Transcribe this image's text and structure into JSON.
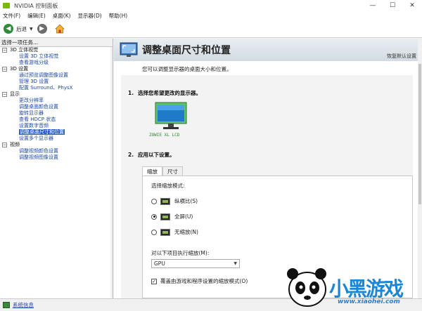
{
  "window": {
    "title": "NVIDIA 控制面板",
    "minimize": "—",
    "maximize": "☐",
    "close": "✕"
  },
  "menu": [
    "文件(F)",
    "编辑(E)",
    "桌面(K)",
    "显示器(D)",
    "帮助(H)"
  ],
  "toolbar": {
    "back_label": "后退",
    "back_dropdown": "▼"
  },
  "sidebar": {
    "header": "选择一项任务...",
    "categories": [
      {
        "label": "3D 立体视觉",
        "toggle": "−",
        "items": [
          {
            "label": "设置 3D 立体视觉"
          },
          {
            "label": "查看游戏分级"
          }
        ]
      },
      {
        "label": "3D 设置",
        "toggle": "−",
        "items": [
          {
            "label": "通过预览调整图像设置"
          },
          {
            "label": "管理 3D 设置"
          },
          {
            "label": "配置 Surround、PhysX"
          }
        ]
      },
      {
        "label": "显示",
        "toggle": "−",
        "items": [
          {
            "label": "更改分辨率"
          },
          {
            "label": "调整桌面颜色设置"
          },
          {
            "label": "旋转显示器"
          },
          {
            "label": "查看 HDCP 状态"
          },
          {
            "label": "设置数字音频"
          },
          {
            "label": "调整桌面尺寸和位置",
            "selected": true
          },
          {
            "label": "设置多个显示器"
          }
        ]
      },
      {
        "label": "视频",
        "toggle": "−",
        "items": [
          {
            "label": "调整视频颜色设置"
          },
          {
            "label": "调整视频图像设置"
          }
        ]
      }
    ]
  },
  "main": {
    "title": "调整桌面尺寸和位置",
    "restore_defaults": "恢复默认设置",
    "description": "您可以调整显示器的桌面大小和位置。",
    "section1": {
      "number": "1.",
      "title": "选择您希望更改的显示器。",
      "monitor_label": "ZOWIE XL LCD"
    },
    "section2": {
      "number": "2.",
      "title": "应用以下设置。"
    },
    "tabs": [
      "缩放",
      "尺寸"
    ],
    "scaling_mode_label": "选择缩放模式:",
    "modes": [
      {
        "label": "纵横比(S)",
        "selected": false
      },
      {
        "label": "全屏(U)",
        "selected": true
      },
      {
        "label": "无缩放(N)",
        "selected": false
      }
    ],
    "perform_scaling_label": "对以下项目执行缩放(M):",
    "perform_scaling_value": "GPU",
    "override_checkbox": {
      "label": "覆盖由游戏和程序设置的缩放模式(O)",
      "checked": true
    }
  },
  "status": {
    "system_info": "系统信息"
  },
  "watermark": {
    "brand": "小黑游戏",
    "url": "www.xiaohei.com"
  }
}
